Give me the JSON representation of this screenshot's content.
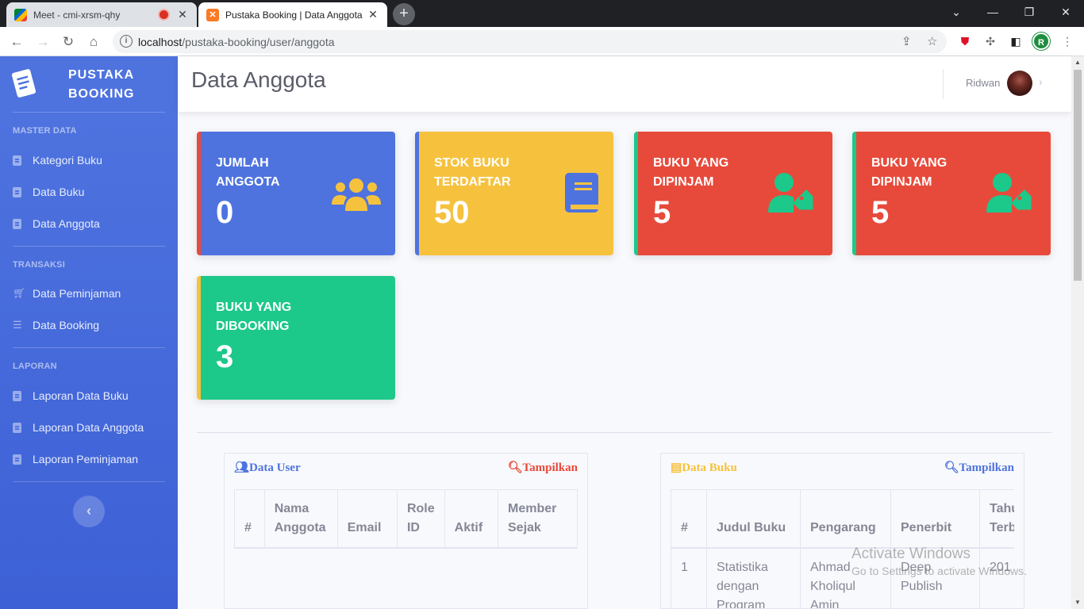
{
  "browser": {
    "tabs": [
      {
        "title": "Meet - cmi-xrsm-qhy",
        "active": false
      },
      {
        "title": "Pustaka Booking | Data Anggota",
        "active": true
      }
    ],
    "new_tab": "+",
    "url_host": "localhost",
    "url_path": "/pustaka-booking/user/anggota",
    "profile_initial": "R"
  },
  "sidebar": {
    "brand_line1": "PUSTAKA",
    "brand_line2": "BOOKING",
    "sections": [
      {
        "heading": "MASTER DATA",
        "items": [
          "Kategori Buku",
          "Data Buku",
          "Data Anggota"
        ]
      },
      {
        "heading": "TRANSAKSI",
        "items": [
          "Data Peminjaman",
          "Data Booking"
        ]
      },
      {
        "heading": "LAPORAN",
        "items": [
          "Laporan Data Buku",
          "Laporan Data Anggota",
          "Laporan Peminjaman"
        ]
      }
    ],
    "toggle": "‹"
  },
  "topbar": {
    "title": "Data Anggota",
    "user": "Ridwan"
  },
  "cards": [
    {
      "line1": "JUMLAH",
      "line2": "ANGGOTA",
      "value": "0",
      "icon": "users-icon",
      "bg": "#4e73df",
      "border": "#e74a3b"
    },
    {
      "line1": "STOK BUKU",
      "line2": "TERDAFTAR",
      "value": "50",
      "icon": "book-icon",
      "bg": "#f6c23e",
      "border": "#4e73df"
    },
    {
      "line1": "BUKU YANG",
      "line2": "DIPINJAM",
      "value": "5",
      "icon": "user-tag-icon",
      "bg": "#e74a3b",
      "border": "#1cc88a"
    },
    {
      "line1": "BUKU YANG",
      "line2": "DIPINJAM",
      "value": "5",
      "icon": "user-tag-icon",
      "bg": "#e74a3b",
      "border": "#1cc88a"
    },
    {
      "line1": "BUKU YANG",
      "line2": "DIBOOKING",
      "value": "3",
      "icon": "none",
      "bg": "#1cc88a",
      "border": "#f6c23e"
    }
  ],
  "user_panel": {
    "title": "Data User",
    "action": "Tampilkan",
    "columns": [
      "#",
      "Nama Anggota",
      "Email",
      "Role ID",
      "Aktif",
      "Member Sejak"
    ]
  },
  "book_panel": {
    "title": "Data Buku",
    "action": "Tampilkan",
    "columns": [
      "#",
      "Judul Buku",
      "Pengarang",
      "Penerbit",
      "Tahun Terbit"
    ],
    "rows": [
      [
        "1",
        "Statistika dengan Program",
        "Ahmad Kholiqul Amin",
        "Deep Publish",
        "201"
      ]
    ]
  },
  "watermark": {
    "line1": "Activate Windows",
    "line2": "Go to Settings to activate Windows."
  }
}
